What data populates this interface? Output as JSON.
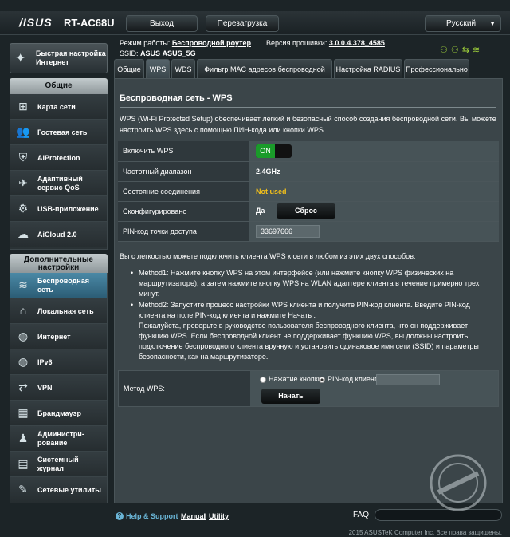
{
  "header": {
    "logo": "/ISUS",
    "model": "RT-AC68U",
    "logout_label": "Выход",
    "reboot_label": "Перезагрузка",
    "language": "Русский"
  },
  "info": {
    "mode_label": "Режим работы:",
    "mode_value": "Беспроводной роутер",
    "firmware_label": "Версия прошивки:",
    "firmware_value": "3.0.0.4.378_4585",
    "ssid_label": "SSID:",
    "ssid_1": "ASUS",
    "ssid_2": "ASUS_5G"
  },
  "sidebar": {
    "quick_setup": "Быстрая настройка Интернет",
    "general_header": "Общие",
    "general_items": [
      {
        "label": "Карта сети",
        "icon": "network-map-icon"
      },
      {
        "label": "Гостевая сеть",
        "icon": "guest-network-icon"
      },
      {
        "label": "AiProtection",
        "icon": "aiprotection-icon"
      },
      {
        "label": "Адаптивный сервис QoS",
        "icon": "qos-icon"
      },
      {
        "label": "USB-приложение",
        "icon": "usb-icon"
      },
      {
        "label": "AiCloud 2.0",
        "icon": "cloud-icon"
      }
    ],
    "advanced_header": "Дополнительные настройки",
    "advanced_items": [
      {
        "label": "Беспроводная сеть",
        "icon": "wireless-icon"
      },
      {
        "label": "Локальная сеть",
        "icon": "lan-icon"
      },
      {
        "label": "Интернет",
        "icon": "globe-icon"
      },
      {
        "label": "IPv6",
        "icon": "ipv6-icon"
      },
      {
        "label": "VPN",
        "icon": "vpn-icon"
      },
      {
        "label": "Брандмауэр",
        "icon": "firewall-icon"
      },
      {
        "label": "Администри-рование",
        "icon": "admin-icon"
      },
      {
        "label": "Системный журнал",
        "icon": "syslog-icon"
      },
      {
        "label": "Сетевые утилиты",
        "icon": "tools-icon"
      }
    ]
  },
  "tabs": [
    {
      "label": "Общие"
    },
    {
      "label": "WPS"
    },
    {
      "label": "WDS"
    },
    {
      "label": "Фильтр MAC адресов беспроводной сети"
    },
    {
      "label": "Настройка RADIUS"
    },
    {
      "label": "Профессионально"
    }
  ],
  "main": {
    "title": "Беспроводная сеть - WPS",
    "intro": "WPS (Wi-Fi Protected Setup) обеспечивает легкий и безопасный способ создания беспроводной сети. Вы можете настроить WPS здесь с помощью ПИН-кода или кнопки WPS",
    "settings": {
      "enable_label": "Включить WPS",
      "enable_value": "ON",
      "band_label": "Частотный диапазон",
      "band_value": "2.4GHz",
      "status_label": "Состояние соединения",
      "status_value": "Not used",
      "configured_label": "Сконфигурировано",
      "configured_value": "Да",
      "reset_label": "Сброс",
      "pin_label": "PIN-код точки доступа",
      "pin_value": "33697666"
    },
    "connect_text": "Вы с легкостью можете подключить клиента WPS к сети в любом из этих двух способов:",
    "method1": "Method1: Нажмите кнопку WPS на этом интерфейсе (или нажмите кнопку WPS физических на маршрутизаторе), а затем нажмите кнопку WPS на WLAN адаптере клиента в течение примерно трех минут.",
    "method2": "Method2: Запустите процесс настройки WPS клиента и получите PIN-код клиента. Введите PIN-код клиента на поле PIN-код клиента и нажмите Начать .",
    "method2_note": "Пожалуйста, проверьте в руководстве пользователя беспроводного клиента, что он поддерживает функцию WPS. Если беспроводной клиент не поддерживает функцию WPS, вы должны настроить подключение беспроводного клиента вручную и установить одинаковое имя сети (SSID) и параметры безопасности, как на маршрутизаторе.",
    "wps_method_label": "Метод WPS:",
    "radio_button_label": "Нажатие кнопки",
    "radio_pin_label": "PIN-код клиента",
    "start_label": "Начать"
  },
  "footer": {
    "help_label": "Help & Support",
    "manual_label": "Manual",
    "separator": "|",
    "utility_label": "Utility",
    "faq_label": "FAQ",
    "copyright": "2015 ASUSTeK Computer Inc. Все права защищены."
  },
  "colors": {
    "accent": "#4b89a6",
    "toggle_on": "#1a9b2a",
    "status_warning": "#f3c01a"
  }
}
